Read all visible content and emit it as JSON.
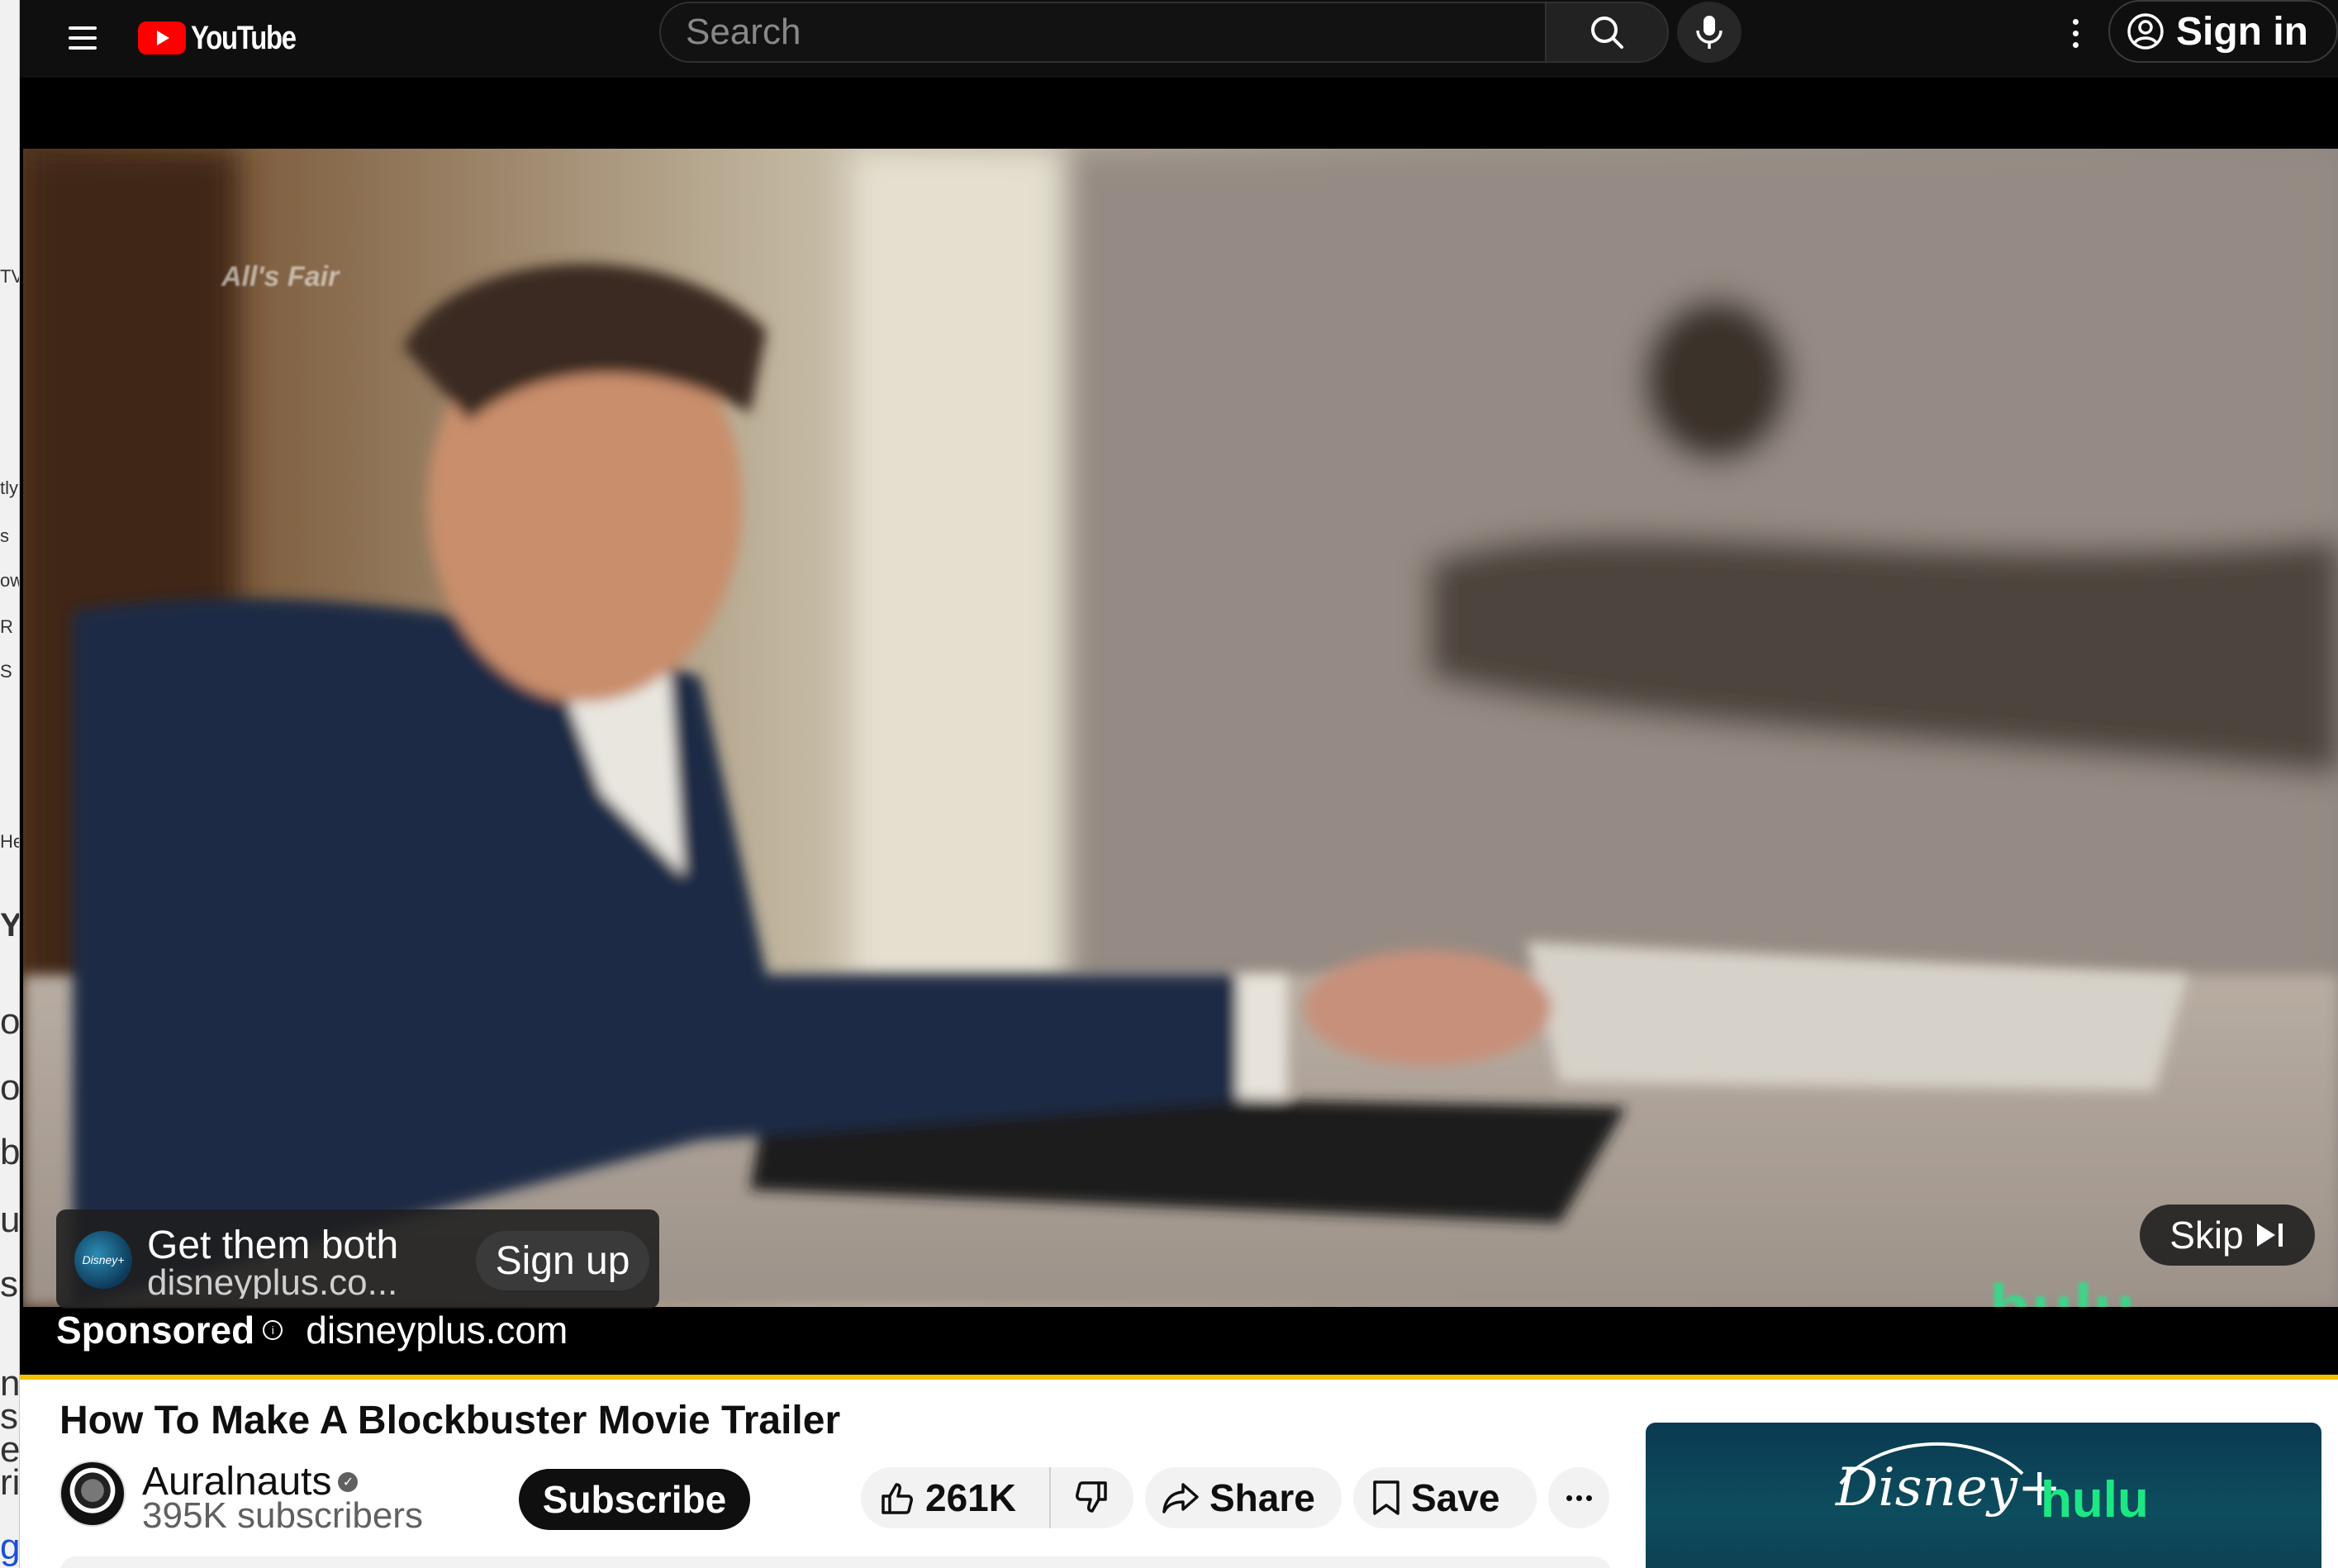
{
  "background_window": {
    "fragments": [
      "TV",
      "tly",
      "s",
      "ow",
      "R",
      "S",
      "He",
      "Y",
      "or",
      "o",
      "b",
      "u",
      "s",
      "n",
      "s,",
      "e",
      "ri",
      "gi"
    ]
  },
  "header": {
    "logo_text": "YouTube",
    "search_placeholder": "Search",
    "sign_in_label": "Sign in"
  },
  "player": {
    "video_watermark": "All's Fair",
    "hulu_watermark": "hulu",
    "ad": {
      "title": "Get them both",
      "url": "disneyplus.co...",
      "cta": "Sign up",
      "avatar_text": "Disney+",
      "sponsored_label": "Sponsored",
      "sponsored_domain": "disneyplus.com"
    },
    "skip_label": "Skip",
    "ad_progress": 1.0,
    "progress_color": "#f2c200"
  },
  "video": {
    "title": "How To Make A Blockbuster Movie Trailer",
    "channel": "Auralnauts",
    "subscribers": "395K subscribers",
    "subscribe_label": "Subscribe",
    "likes": "261K",
    "share_label": "Share",
    "save_label": "Save"
  },
  "side_ad": {
    "brand_1": "Disney+",
    "brand_2": "hulu"
  },
  "colors": {
    "brand_red": "#ff0000",
    "header_bg": "#0f0f0f",
    "hulu_green": "#1ce783"
  },
  "icons": [
    "menu-icon",
    "youtube-logo-icon",
    "search-icon",
    "mic-icon",
    "more-vert-icon",
    "account-circle-icon",
    "info-icon",
    "skip-next-icon",
    "like-icon",
    "dislike-icon",
    "share-icon",
    "save-icon",
    "more-horiz-icon",
    "verified-icon"
  ]
}
